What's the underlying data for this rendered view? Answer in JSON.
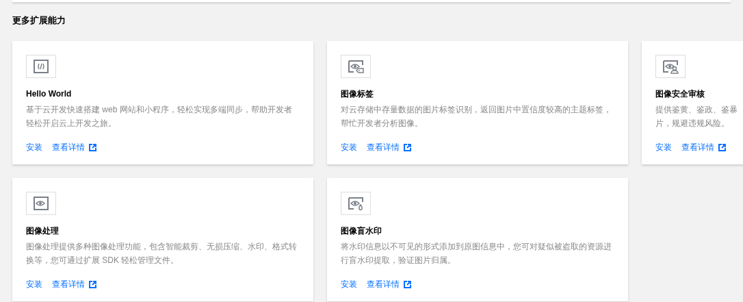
{
  "section_title": "更多扩展能力",
  "cards": [
    {
      "kind": "code",
      "title": "Hello World",
      "description_lines": [
        "基于云开发快速搭建 web 网站和小程序，轻松实现多端同步，帮助开发者",
        "轻松开启云上开发之旅。"
      ],
      "install": "安装",
      "details": "查看详情"
    },
    {
      "kind": "eye-tag",
      "title": "图像标签",
      "description_lines": [
        "对云存储中存量数据的图片标签识别，返回图片中置信度较高的主题标签，",
        "帮忙开发者分析图像。"
      ],
      "install": "安装",
      "details": "查看详情"
    },
    {
      "kind": "eye-person",
      "title": "图像安全审核",
      "description_lines": [
        "提供鉴黄、鉴政、鉴暴",
        "片，规避违规风险。"
      ],
      "install": "安装",
      "details": "查看详情"
    },
    {
      "kind": "eye",
      "title": "图像处理",
      "description_lines": [
        "图像处理提供多种图像处理功能，包含智能裁剪、无损压缩、水印、格式转",
        "换等，您可通过扩展 SDK 轻松管理文件。"
      ],
      "install": "安装",
      "details": "查看详情"
    },
    {
      "kind": "eye-drop",
      "title": "图像盲水印",
      "description_lines": [
        "将水印信息以不可见的形式添加到原图信息中，您可对疑似被盗取的资源进",
        "行盲水印提取，验证图片归属。"
      ],
      "install": "安装",
      "details": "查看详情"
    }
  ]
}
